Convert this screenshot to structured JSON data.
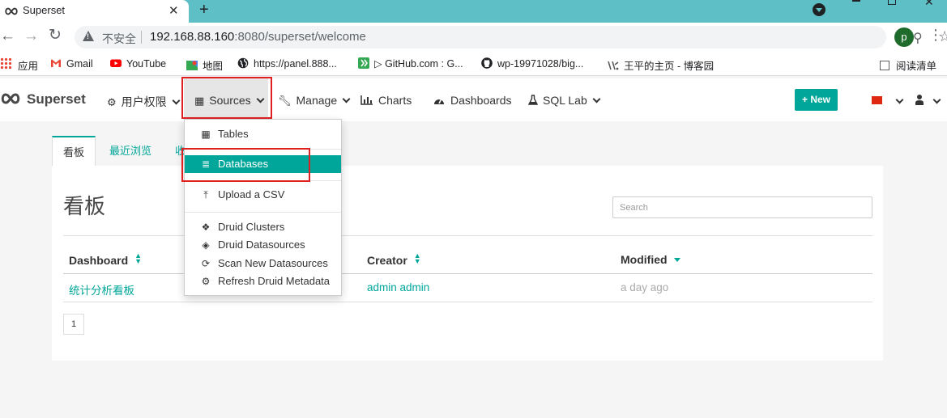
{
  "browser": {
    "tab_title": "Superset",
    "tab_close": "✕",
    "new_tab": "+",
    "url_insecure_label": "不安全",
    "url_host": "192.168.88.160",
    "url_rest": ":8080/superset/welcome",
    "profile_initial": "p",
    "bookmarks": [
      {
        "label": "应用",
        "icon": "apps-icon"
      },
      {
        "label": "Gmail",
        "icon": "gmail-icon"
      },
      {
        "label": "YouTube",
        "icon": "youtube-icon"
      },
      {
        "label": "地图",
        "icon": "maps-icon"
      },
      {
        "label": "https://panel.888...",
        "icon": "globe-icon"
      },
      {
        "label": "▷ GitHub.com : G...",
        "icon": "arrow-badge-icon"
      },
      {
        "label": "wp-19971028/big...",
        "icon": "github-icon"
      },
      {
        "label": "王平的主页 - 博客园",
        "icon": "cnblogs-icon"
      }
    ],
    "reading_list": "阅读清单"
  },
  "navbar": {
    "brand": "Superset",
    "menus": [
      {
        "label": "用户权限",
        "icon": "cogs-icon",
        "dropdown": true
      },
      {
        "label": "Sources",
        "icon": "table-icon",
        "dropdown": true,
        "active": true
      },
      {
        "label": "Manage",
        "icon": "wrench-icon",
        "dropdown": true
      },
      {
        "label": "Charts",
        "icon": "bar-chart-icon",
        "dropdown": false
      },
      {
        "label": "Dashboards",
        "icon": "dashboard-icon",
        "dropdown": false
      },
      {
        "label": "SQL Lab",
        "icon": "flask-icon",
        "dropdown": true
      }
    ],
    "new_button": "+ New",
    "language": "Chinese",
    "colors": {
      "accent": "#00a699",
      "highlight": "#e02020"
    }
  },
  "sources_dropdown": {
    "items": [
      {
        "label": "Tables",
        "icon": "table-icon"
      },
      {
        "label": "Databases",
        "icon": "database-icon",
        "active": true
      },
      {
        "label": "Upload a CSV",
        "icon": "upload-icon"
      },
      {
        "label": "Druid Clusters",
        "icon": "cubes-icon"
      },
      {
        "label": "Druid Datasources",
        "icon": "cube-icon"
      },
      {
        "label": "Scan New Datasources",
        "icon": "refresh-icon"
      },
      {
        "label": "Refresh Druid Metadata",
        "icon": "cog-icon"
      }
    ]
  },
  "content": {
    "tabs": [
      "看板",
      "最近浏览",
      "收"
    ],
    "title": "看板",
    "search_placeholder": "Search",
    "table": {
      "columns": [
        "Dashboard",
        "Creator",
        "Modified"
      ],
      "rows": [
        {
          "dashboard": "统计分析看板",
          "creator": "admin admin",
          "modified": "a day ago"
        }
      ]
    },
    "page": "1"
  }
}
